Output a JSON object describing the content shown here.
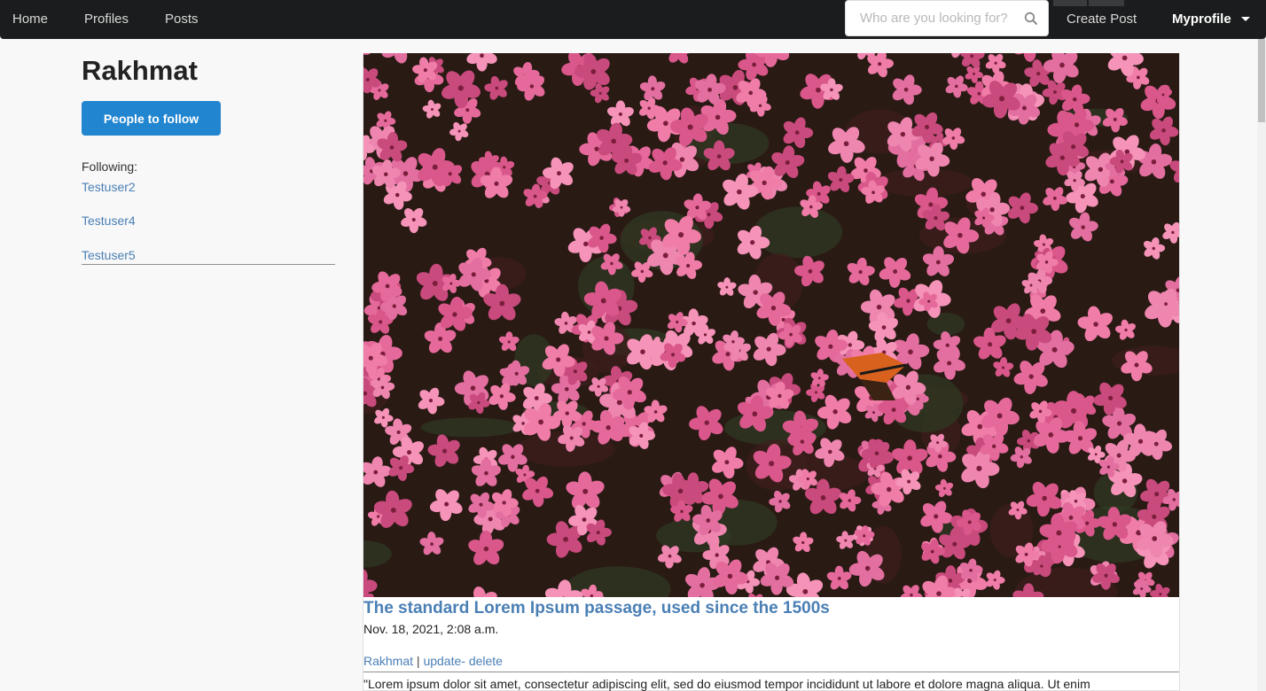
{
  "nav": {
    "home": "Home",
    "profiles": "Profiles",
    "posts": "Posts",
    "search_placeholder": "Who are you looking for?",
    "create_post": "Create Post",
    "myprofile": "Myprofile"
  },
  "sidebar": {
    "profile_name": "Rakhmat",
    "follow_button": "People to follow",
    "following_label": "Following:",
    "following": [
      "Testuser2",
      "Testuser4",
      "Testuser5"
    ]
  },
  "post": {
    "title": "The standard Lorem Ipsum passage, used since the 1500s",
    "date": "Nov. 18, 2021, 2:08 a.m.",
    "author": "Rakhmat",
    "separator": " | ",
    "update": "update-",
    "delete": " delete",
    "body": "\"Lorem ipsum dolor sit amet, consectetur adipiscing elit, sed do eiusmod tempor incididunt ut labore et dolore magna aliqua. Ut enim"
  },
  "colors": {
    "navbar": "#1b1c1d",
    "accent_button": "#2185d0",
    "link": "#4a7fb5"
  },
  "icons": {
    "search": "search-icon",
    "dropdown": "caret-down-icon"
  }
}
